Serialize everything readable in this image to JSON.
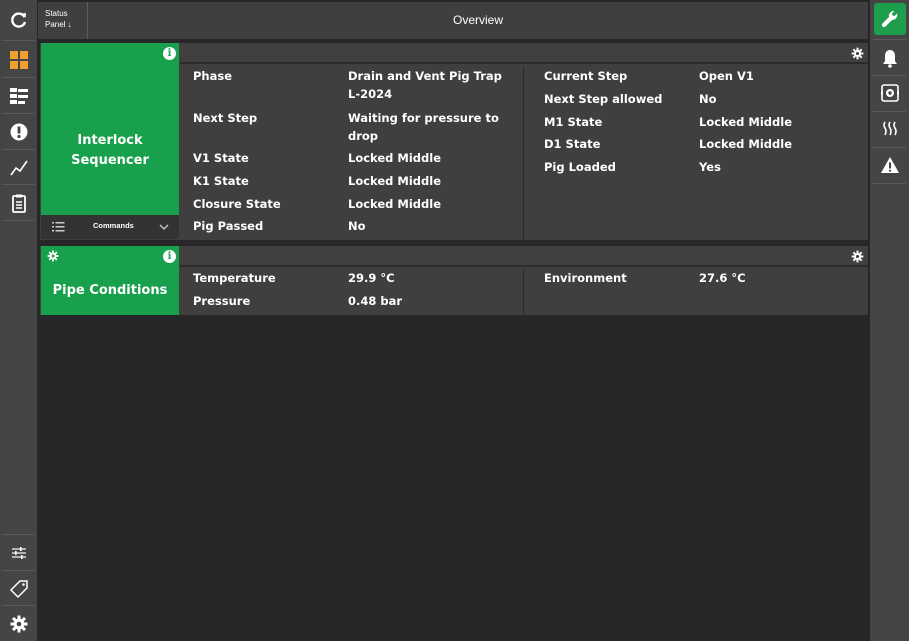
{
  "topbar": {
    "status_line1": "Status",
    "status_line2": "Panel ↓",
    "title": "Overview"
  },
  "left_rail": {
    "top_icons": [
      "refresh-icon",
      "dashboard-icon",
      "tree-icon",
      "alert-icon",
      "trend-icon",
      "clipboard-icon"
    ],
    "bottom_icons": [
      "sliders-icon",
      "tag-icon",
      "settings-icon"
    ]
  },
  "right_rail": {
    "icons": [
      "wrench-icon",
      "bell-icon",
      "camera-target-icon",
      "heating-icon",
      "warning-icon"
    ]
  },
  "interlock": {
    "title_line1": "Interlock",
    "title_line2": "Sequencer",
    "commands_label": "Commands",
    "left": [
      {
        "label": "Phase",
        "value": "Drain and Vent Pig Trap L-2024"
      },
      {
        "label": "Next Step",
        "value": "Waiting for pressure to drop"
      },
      {
        "label": "V1 State",
        "value": "Locked Middle"
      },
      {
        "label": "K1 State",
        "value": "Locked Middle"
      },
      {
        "label": "Closure State",
        "value": "Locked Middle"
      },
      {
        "label": "Pig Passed",
        "value": "No"
      }
    ],
    "right": [
      {
        "label": "Current Step",
        "value": "Open V1"
      },
      {
        "label": "Next Step allowed",
        "value": "No"
      },
      {
        "label": "M1 State",
        "value": "Locked Middle"
      },
      {
        "label": "D1 State",
        "value": "Locked Middle"
      },
      {
        "label": "Pig Loaded",
        "value": "Yes"
      }
    ]
  },
  "pipe": {
    "title": "Pipe Conditions",
    "left": [
      {
        "label": "Temperature",
        "value": "29.9 °C"
      },
      {
        "label": "Pressure",
        "value": "0.48 bar"
      }
    ],
    "right": [
      {
        "label": "Environment",
        "value": "27.6 °C"
      }
    ]
  },
  "colors": {
    "accent_green": "#18a04c",
    "active_orange": "#f0a030",
    "rail": "#454545",
    "panel": "#3f3f3f",
    "background": "#272727"
  }
}
